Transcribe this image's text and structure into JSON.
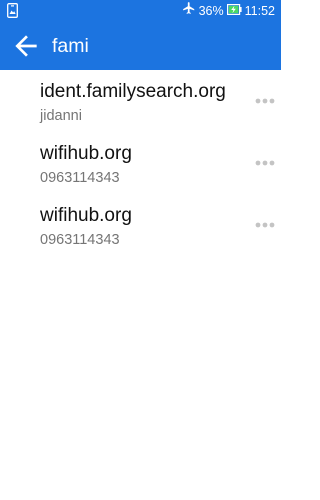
{
  "status_bar": {
    "battery_percent": "36%",
    "time": "11:52",
    "icons": [
      "screenshot-icon",
      "airplane-mode-icon",
      "battery-charging-icon"
    ]
  },
  "app_bar": {
    "back_icon": "back-arrow-icon",
    "search_value": "fami",
    "color": "#1c74e0"
  },
  "results": [
    {
      "title": "ident.familysearch.org",
      "subtitle": "jidanni"
    },
    {
      "title": "wifihub.org",
      "subtitle": "0963114343"
    },
    {
      "title": "wifihub.org",
      "subtitle": "0963114343"
    }
  ]
}
